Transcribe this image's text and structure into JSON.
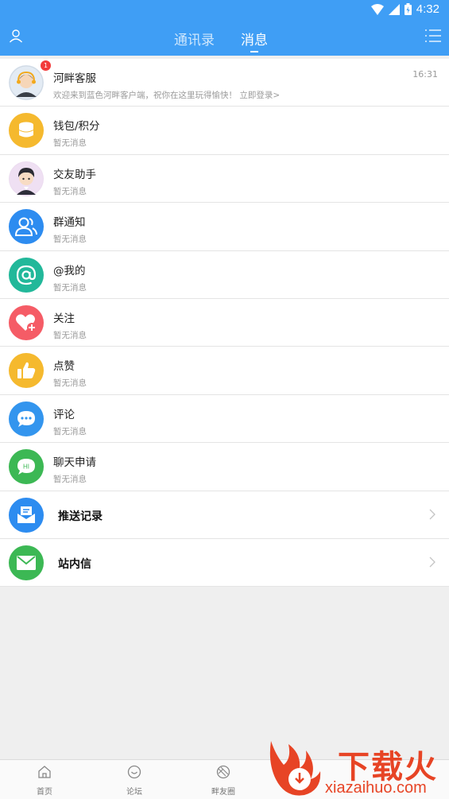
{
  "status_bar": {
    "time": "4:32"
  },
  "header": {
    "tabs": [
      {
        "label": "通讯录",
        "active": false
      },
      {
        "label": "消息",
        "active": true
      }
    ]
  },
  "messages": [
    {
      "title": "河畔客服",
      "subtitle": "欢迎来到蓝色河畔客户端，祝你在这里玩得愉快！ 立即登录>",
      "time": "16:31",
      "badge": "1",
      "icon": "customer-service-avatar"
    },
    {
      "title": "钱包/积分",
      "subtitle": "暂无消息",
      "icon": "wallet-coins-icon",
      "color": "#f5b92e"
    },
    {
      "title": "交友助手",
      "subtitle": "暂无消息",
      "icon": "friend-helper-avatar"
    },
    {
      "title": "群通知",
      "subtitle": "暂无消息",
      "icon": "group-notice-icon",
      "color": "#2d8cf0"
    },
    {
      "title": "@我的",
      "subtitle": "暂无消息",
      "icon": "at-icon",
      "color": "#22b89a"
    },
    {
      "title": "关注",
      "subtitle": "暂无消息",
      "icon": "heart-plus-icon",
      "color": "#f55c66"
    },
    {
      "title": "点赞",
      "subtitle": "暂无消息",
      "icon": "thumbs-up-icon",
      "color": "#f5b92e"
    },
    {
      "title": "评论",
      "subtitle": "暂无消息",
      "icon": "comment-icon",
      "color": "#3395ee"
    },
    {
      "title": "聊天申请",
      "subtitle": "暂无消息",
      "icon": "chat-request-icon",
      "color": "#3cb854"
    }
  ],
  "links": [
    {
      "title": "推送记录",
      "icon": "push-inbox-icon",
      "color": "#2d8cf0"
    },
    {
      "title": "站内信",
      "icon": "mail-icon",
      "color": "#3cb854"
    }
  ],
  "bottom_nav": [
    {
      "label": "首页",
      "icon": "home-icon"
    },
    {
      "label": "论坛",
      "icon": "forum-icon"
    },
    {
      "label": "畔友圈",
      "icon": "circle-icon"
    }
  ],
  "watermark": {
    "text": "下载火",
    "url": "xiazaihuo.com"
  }
}
